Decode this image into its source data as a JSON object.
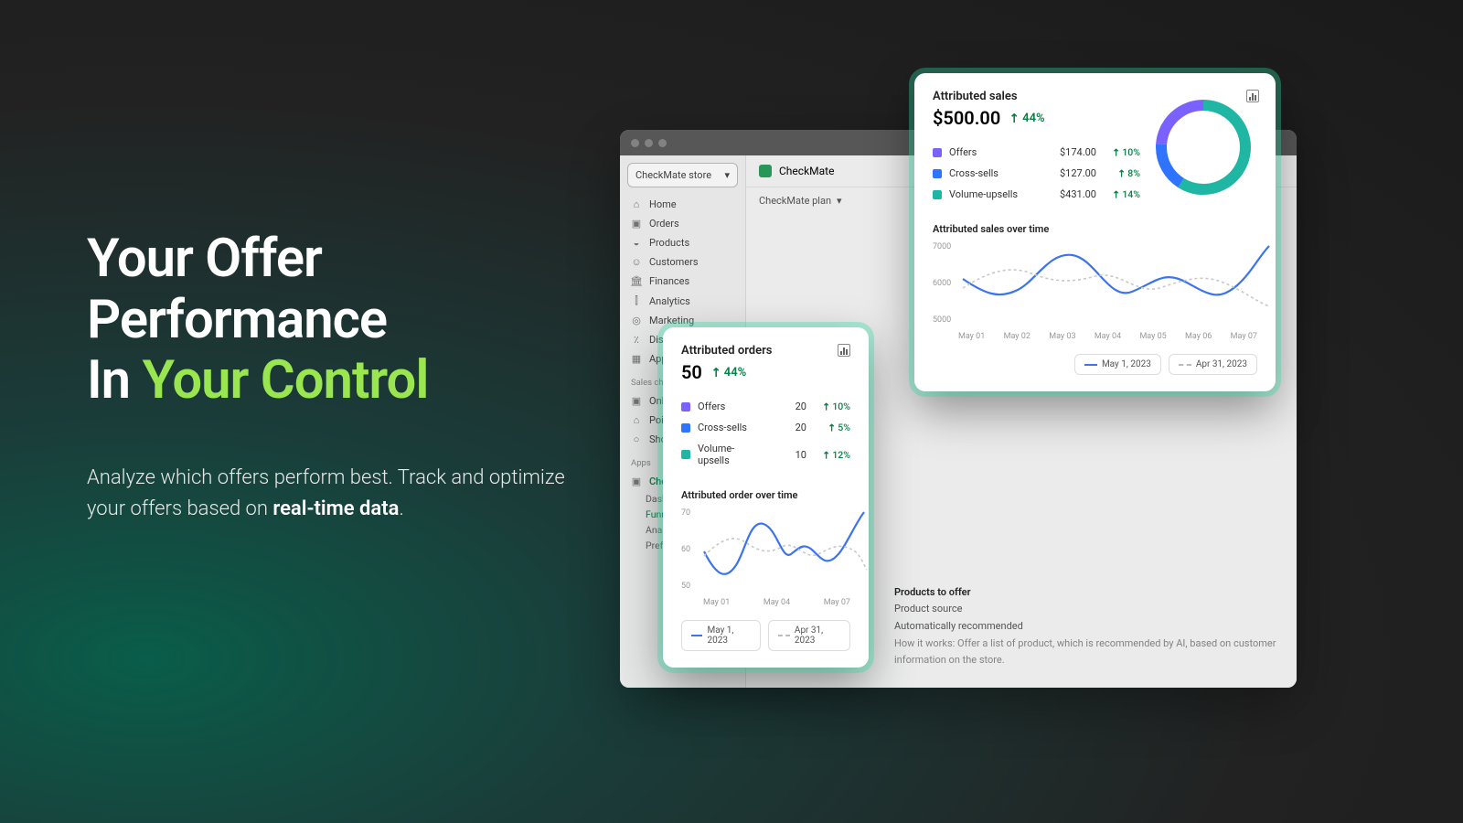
{
  "hero": {
    "line1": "Your Offer",
    "line2": "Performance",
    "line3_pre": "In ",
    "line3_accent": "Your Control",
    "sub_pre": "Analyze which offers perform best. Track and optimize your offers based on ",
    "sub_bold": "real-time data",
    "sub_post": "."
  },
  "browser": {
    "store_selector": "CheckMate store",
    "app_name": "CheckMate",
    "plan_tab": "CheckMate plan",
    "nav": [
      {
        "icon": "⌂",
        "label": "Home"
      },
      {
        "icon": "▣",
        "label": "Orders"
      },
      {
        "icon": "◒",
        "label": "Products"
      },
      {
        "icon": "☺",
        "label": "Customers"
      },
      {
        "icon": "🏛",
        "label": "Finances"
      },
      {
        "icon": "⫿",
        "label": "Analytics"
      },
      {
        "icon": "◎",
        "label": "Marketing"
      },
      {
        "icon": "٪",
        "label": "Discounts"
      },
      {
        "icon": "▦",
        "label": "Apps"
      }
    ],
    "section_sales": "Sales channels",
    "sales_channels": [
      {
        "icon": "▣",
        "label": "Online Store"
      },
      {
        "icon": "⌂",
        "label": "Point of Sale"
      },
      {
        "icon": "○",
        "label": "Shop"
      }
    ],
    "section_apps": "Apps",
    "app_item": "CheckMate",
    "app_sub": [
      {
        "label": "Dashboard",
        "active": false
      },
      {
        "label": "Funnels",
        "active": true
      },
      {
        "label": "Analytics",
        "active": false
      },
      {
        "label": "Preferences",
        "active": false
      }
    ],
    "peek_heading": "Products to offer",
    "peek_l1": "Product source",
    "peek_l2": "Automatically recommended",
    "peek_l3": "How it works: Offer a list of product, which is recommended by AI, based on customer information on the store."
  },
  "orders_card": {
    "title": "Attributed orders",
    "value": "50",
    "delta": "44%",
    "rows": [
      {
        "color": "c-purple",
        "name": "Offers",
        "val": "20",
        "delta": "10%"
      },
      {
        "color": "c-blue",
        "name": "Cross-sells",
        "val": "20",
        "delta": "5%"
      },
      {
        "color": "c-teal",
        "name": "Volume-upsells",
        "val": "10",
        "delta": "12%"
      }
    ],
    "subtitle": "Attributed order over time",
    "yticks": [
      "70",
      "60",
      "50"
    ],
    "xticks": [
      "May 01",
      "May 04",
      "May 07"
    ],
    "pill_solid": "May 1, 2023",
    "pill_dash": "Apr 31, 2023"
  },
  "sales_card": {
    "title": "Attributed sales",
    "value": "$500.00",
    "delta": "44%",
    "rows": [
      {
        "color": "c-purple",
        "name": "Offers",
        "val": "$174.00",
        "delta": "10%"
      },
      {
        "color": "c-blue",
        "name": "Cross-sells",
        "val": "$127.00",
        "delta": "8%"
      },
      {
        "color": "c-teal",
        "name": "Volume-upsells",
        "val": "$431.00",
        "delta": "14%"
      }
    ],
    "subtitle": "Attributed sales over time",
    "yticks": [
      "7000",
      "6000",
      "5000"
    ],
    "xticks": [
      "May 01",
      "May 02",
      "May 03",
      "May 04",
      "May 05",
      "May 06",
      "May 07"
    ],
    "pill_solid": "May 1, 2023",
    "pill_dash": "Apr 31, 2023"
  },
  "chart_data": [
    {
      "id": "attributed_orders_over_time",
      "type": "line",
      "title": "Attributed order over time",
      "xlabel": "",
      "ylabel": "",
      "ylim": [
        50,
        70
      ],
      "categories": [
        "May 01",
        "May 02",
        "May 03",
        "May 04",
        "May 05",
        "May 06",
        "May 07"
      ],
      "series": [
        {
          "name": "May 1, 2023",
          "style": "solid",
          "color": "#3b74ef",
          "values": [
            58,
            54,
            67,
            58,
            61,
            57,
            70
          ]
        },
        {
          "name": "Apr 31, 2023",
          "style": "dashed",
          "color": "#c8c8c8",
          "values": [
            57,
            63,
            59,
            61,
            56,
            61,
            54
          ]
        }
      ]
    },
    {
      "id": "attributed_sales_over_time",
      "type": "line",
      "title": "Attributed sales over time",
      "xlabel": "",
      "ylabel": "",
      "ylim": [
        5000,
        7000
      ],
      "categories": [
        "May 01",
        "May 02",
        "May 03",
        "May 04",
        "May 05",
        "May 06",
        "May 07"
      ],
      "series": [
        {
          "name": "May 1, 2023",
          "style": "solid",
          "color": "#3b74ef",
          "values": [
            6100,
            5800,
            6700,
            5700,
            6200,
            5700,
            7000
          ]
        },
        {
          "name": "Apr 31, 2023",
          "style": "dashed",
          "color": "#c8c8c8",
          "values": [
            5900,
            6300,
            6000,
            6200,
            5700,
            6100,
            5500
          ]
        }
      ]
    },
    {
      "id": "attributed_sales_breakdown",
      "type": "pie",
      "title": "Attributed sales",
      "series": [
        {
          "name": "Offers",
          "value": 174,
          "color": "#7b61ff"
        },
        {
          "name": "Cross-sells",
          "value": 127,
          "color": "#2f74ff"
        },
        {
          "name": "Volume-upsells",
          "value": 431,
          "color": "#1fb6a3"
        }
      ]
    }
  ]
}
